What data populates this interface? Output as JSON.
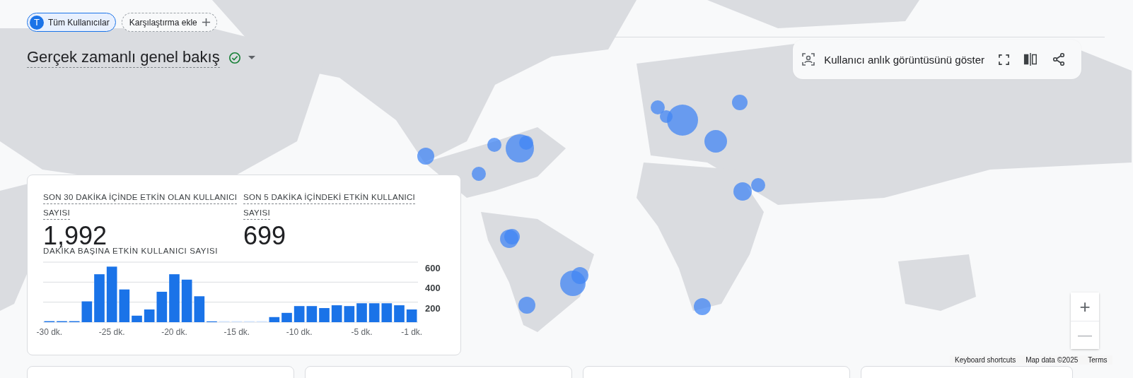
{
  "segments": [
    {
      "label": "Tüm Kullanıcılar",
      "avatar": "T",
      "kind": "segment"
    },
    {
      "label": "Karşılaştırma ekle",
      "kind": "add"
    }
  ],
  "title": "Gerçek zamanlı genel bakış",
  "toolbar": {
    "snapshot_label": "Kullanıcı anlık görüntüsünü göster"
  },
  "metrics": [
    {
      "label": "SON 30 DAKİKA İÇİNDE ETKİN OLAN KULLANICI SAYISI",
      "value": "1,992"
    },
    {
      "label": "SON 5 DAKİKA İÇİNDEKİ ETKİN KULLANICI SAYISI",
      "value": "699"
    }
  ],
  "chart": {
    "title": "DAKİKA BAŞINA ETKİN KULLANICI SAYISI",
    "chart_data": {
      "type": "bar",
      "x": [
        -30,
        -29,
        -28,
        -27,
        -26,
        -25,
        -24,
        -23,
        -22,
        -21,
        -20,
        -19,
        -18,
        -17,
        -16,
        -15,
        -14,
        -13,
        -12,
        -11,
        -10,
        -9,
        -8,
        -7,
        -6,
        -5,
        -4,
        -3,
        -2,
        -1
      ],
      "series": [
        {
          "color": "#1a73e8",
          "values": [
            10,
            10,
            10,
            208,
            479,
            555,
            327,
            65,
            127,
            304,
            479,
            425,
            259,
            8,
            null,
            null,
            null,
            null,
            51,
            93,
            161,
            161,
            141,
            169,
            161,
            189,
            189,
            189,
            169,
            127
          ]
        }
      ],
      "xlim": [
        -30.5,
        -0.5
      ],
      "ylim": [
        0,
        600
      ],
      "yticks": [
        200,
        400,
        600
      ],
      "xticks": [
        {
          "value": -30,
          "label": "-30 dk."
        },
        {
          "value": -25,
          "label": "-25 dk."
        },
        {
          "value": -20,
          "label": "-20 dk."
        },
        {
          "value": -15,
          "label": "-15 dk."
        },
        {
          "value": -10,
          "label": "-10 dk."
        },
        {
          "value": -5,
          "label": "-5 dk."
        },
        {
          "value": -1,
          "label": "-1 dk."
        }
      ]
    }
  },
  "zoom": {
    "plus": "+",
    "minus": "—"
  },
  "attribution": [
    "Keyboard shortcuts",
    "Map data ©2025",
    "Terms"
  ]
}
